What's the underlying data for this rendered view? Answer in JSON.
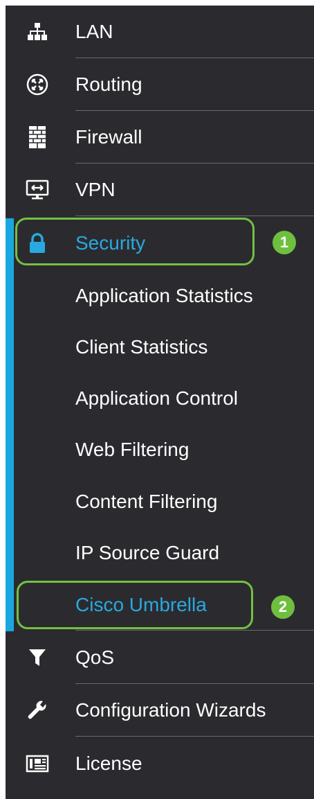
{
  "nav": {
    "items": [
      {
        "label": "LAN",
        "icon": "network-icon"
      },
      {
        "label": "Routing",
        "icon": "routing-icon"
      },
      {
        "label": "Firewall",
        "icon": "firewall-icon"
      },
      {
        "label": "VPN",
        "icon": "vpn-icon"
      },
      {
        "label": "Security",
        "icon": "lock-icon"
      }
    ],
    "security_sub": [
      {
        "label": "Application Statistics"
      },
      {
        "label": "Client Statistics"
      },
      {
        "label": "Application Control"
      },
      {
        "label": "Web Filtering"
      },
      {
        "label": "Content Filtering"
      },
      {
        "label": "IP Source Guard"
      },
      {
        "label": "Cisco Umbrella"
      }
    ],
    "bottom_items": [
      {
        "label": "QoS",
        "icon": "filter-icon"
      },
      {
        "label": "Configuration Wizards",
        "icon": "wrench-icon"
      },
      {
        "label": "License",
        "icon": "license-icon"
      }
    ]
  },
  "callouts": [
    {
      "number": "1",
      "target": "Security"
    },
    {
      "number": "2",
      "target": "Cisco Umbrella"
    }
  ],
  "colors": {
    "sidebar_bg": "#2b2b2f",
    "active_bar": "#1aa7e0",
    "active_text": "#28a9e0",
    "callout_green": "#75c043",
    "badge_green": "#6fbf3f"
  }
}
